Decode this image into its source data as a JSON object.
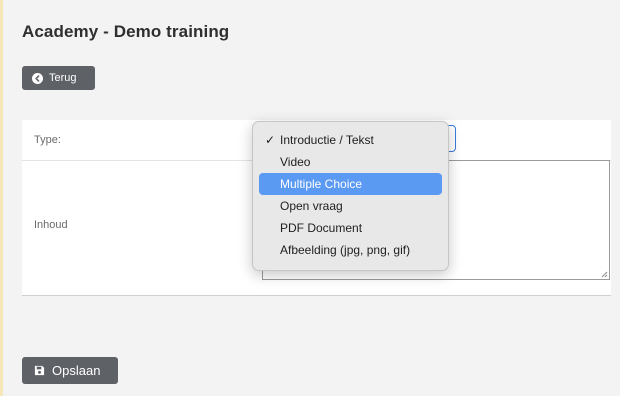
{
  "page": {
    "title": "Academy - Demo training"
  },
  "back_button": {
    "label": "Terug",
    "icon": "circle-arrow-left-icon"
  },
  "form": {
    "type_label": "Type:",
    "content_label": "Inhoud"
  },
  "type_select": {
    "selected": "Introductie / Tekst",
    "highlighted": "Multiple Choice",
    "options": [
      "Introductie / Tekst",
      "Video",
      "Multiple Choice",
      "Open vraag",
      "PDF Document",
      "Afbeelding (jpg, png, gif)"
    ],
    "check_mark": "✓"
  },
  "save_button": {
    "label": "Opslaan",
    "icon": "floppy-disk-icon"
  },
  "colors": {
    "button_bg": "#5e6166",
    "highlight": "#5b9af2",
    "focus_border": "#3b7bd8",
    "page_bg": "#f3f3f3"
  }
}
